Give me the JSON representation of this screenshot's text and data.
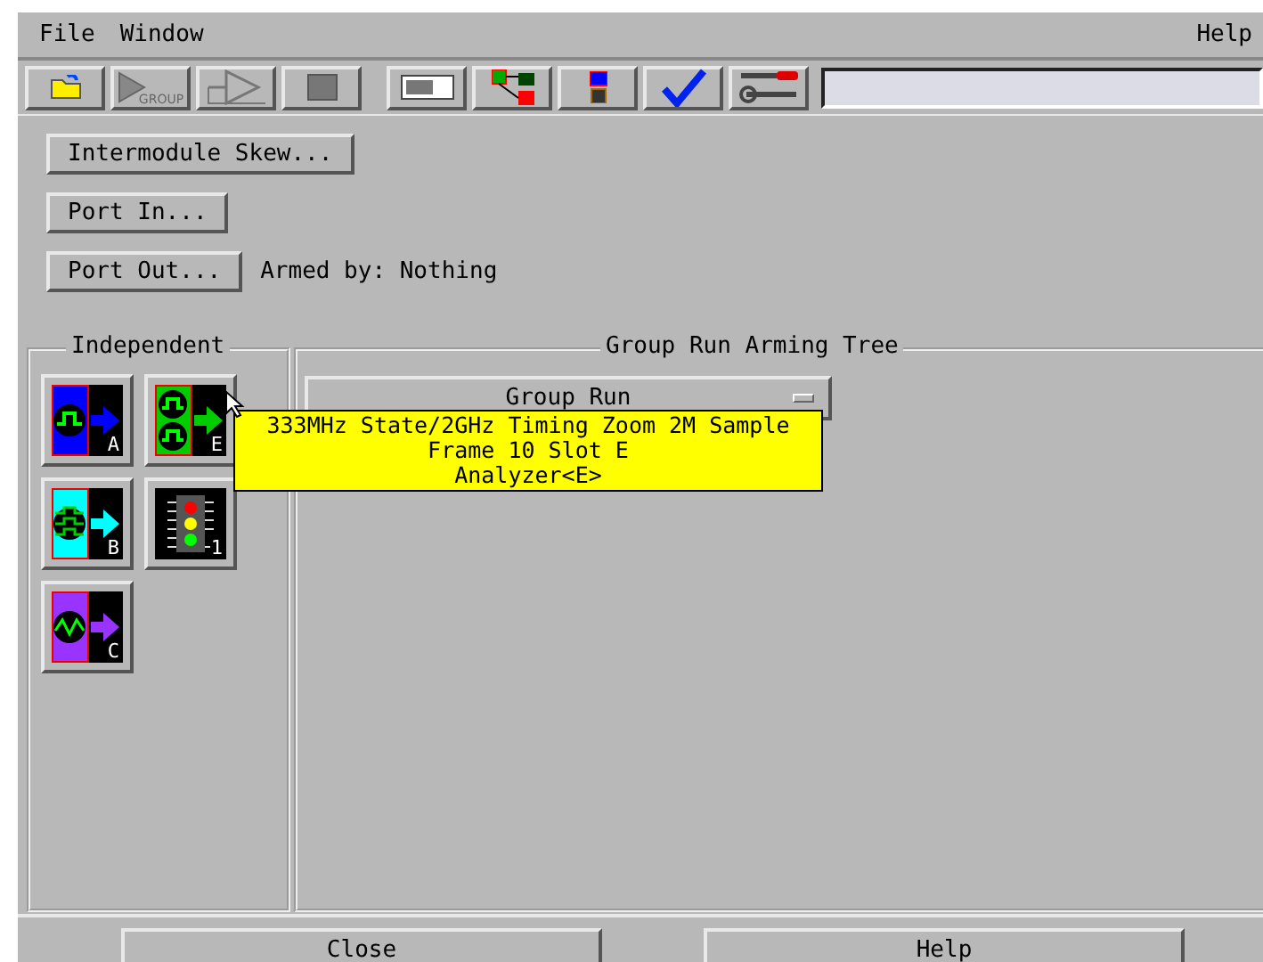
{
  "menubar": {
    "menus": [
      "File",
      "Window"
    ],
    "help": "Help"
  },
  "toolbar": {
    "buttons": [
      {
        "kind": "folder"
      },
      {
        "kind": "group-run",
        "label": "GROUP"
      },
      {
        "kind": "run"
      },
      {
        "kind": "stop"
      },
      {
        "kind": "panel"
      },
      {
        "kind": "tree"
      },
      {
        "kind": "module"
      },
      {
        "kind": "check"
      },
      {
        "kind": "tools"
      }
    ]
  },
  "actions": {
    "buttons": [
      "Intermodule Skew...",
      "Port In...",
      "Port Out..."
    ],
    "armed_status": "Armed by: Nothing"
  },
  "independent": {
    "title": "Independent",
    "modules": [
      {
        "kind": "timing",
        "letter": "A",
        "color": "#0000ff"
      },
      {
        "kind": "state-timing",
        "letter": "E",
        "color": "#00cc00"
      },
      {
        "kind": "state",
        "letter": "B",
        "color": "#00ffff"
      },
      {
        "kind": "chip",
        "letter": "1"
      },
      {
        "kind": "scope",
        "letter": "C",
        "color": "#9933ff"
      }
    ]
  },
  "arming_tree": {
    "title": "Group Run Arming Tree",
    "root": "Group Run"
  },
  "tooltip": {
    "lines": [
      "333MHz State/2GHz Timing Zoom 2M Sample",
      "Frame 10 Slot E",
      "Analyzer<E>"
    ]
  },
  "footer": {
    "buttons": [
      "Close",
      "Help"
    ]
  }
}
